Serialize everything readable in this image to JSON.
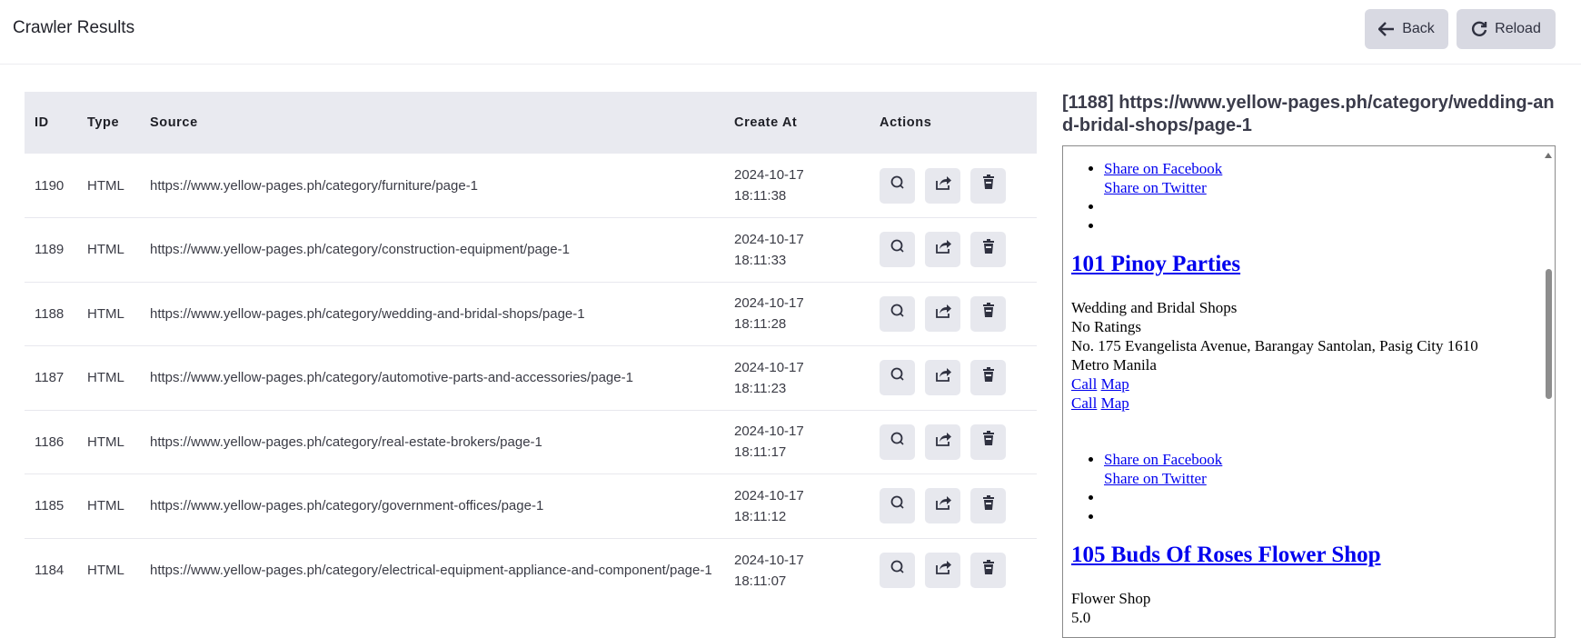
{
  "header": {
    "title": "Crawler Results",
    "back_label": "Back",
    "reload_label": "Reload"
  },
  "table": {
    "columns": [
      "ID",
      "Type",
      "Source",
      "Create At",
      "Actions"
    ],
    "rows": [
      {
        "id": "1190",
        "type": "HTML",
        "source": "https://www.yellow-pages.ph/category/furniture/page-1",
        "date": "2024-10-17",
        "time": "18:11:38"
      },
      {
        "id": "1189",
        "type": "HTML",
        "source": "https://www.yellow-pages.ph/category/construction-equipment/page-1",
        "date": "2024-10-17",
        "time": "18:11:33"
      },
      {
        "id": "1188",
        "type": "HTML",
        "source": "https://www.yellow-pages.ph/category/wedding-and-bridal-shops/page-1",
        "date": "2024-10-17",
        "time": "18:11:28"
      },
      {
        "id": "1187",
        "type": "HTML",
        "source": "https://www.yellow-pages.ph/category/automotive-parts-and-accessories/page-1",
        "date": "2024-10-17",
        "time": "18:11:23"
      },
      {
        "id": "1186",
        "type": "HTML",
        "source": "https://www.yellow-pages.ph/category/real-estate-brokers/page-1",
        "date": "2024-10-17",
        "time": "18:11:17"
      },
      {
        "id": "1185",
        "type": "HTML",
        "source": "https://www.yellow-pages.ph/category/government-offices/page-1",
        "date": "2024-10-17",
        "time": "18:11:12"
      },
      {
        "id": "1184",
        "type": "HTML",
        "source": "https://www.yellow-pages.ph/category/electrical-equipment-appliance-and-component/page-1",
        "date": "2024-10-17",
        "time": "18:11:07"
      }
    ],
    "action_icons": [
      "search-icon",
      "share-icon",
      "trash-icon"
    ]
  },
  "preview": {
    "title": "[1188] https://www.yellow-pages.ph/category/wedding-and-bridal-shops/page-1",
    "share_facebook": "Share on Facebook",
    "share_twitter": "Share on Twitter",
    "listing1": {
      "name": "101 Pinoy Parties",
      "category": "Wedding and Bridal Shops",
      "rating": "No Ratings",
      "address": "No. 175 Evangelista Avenue, Barangay Santolan, Pasig City 1610",
      "region": "Metro Manila",
      "call": "Call",
      "map": "Map"
    },
    "listing2": {
      "name": "105 Buds Of Roses Flower Shop",
      "category": "Flower Shop",
      "rating": "5.0"
    }
  },
  "colors": {
    "header_bg": "#e9eaf0",
    "button_bg": "#d8d9e2",
    "action_bg": "#e7e8ee",
    "link": "#0000ee"
  }
}
